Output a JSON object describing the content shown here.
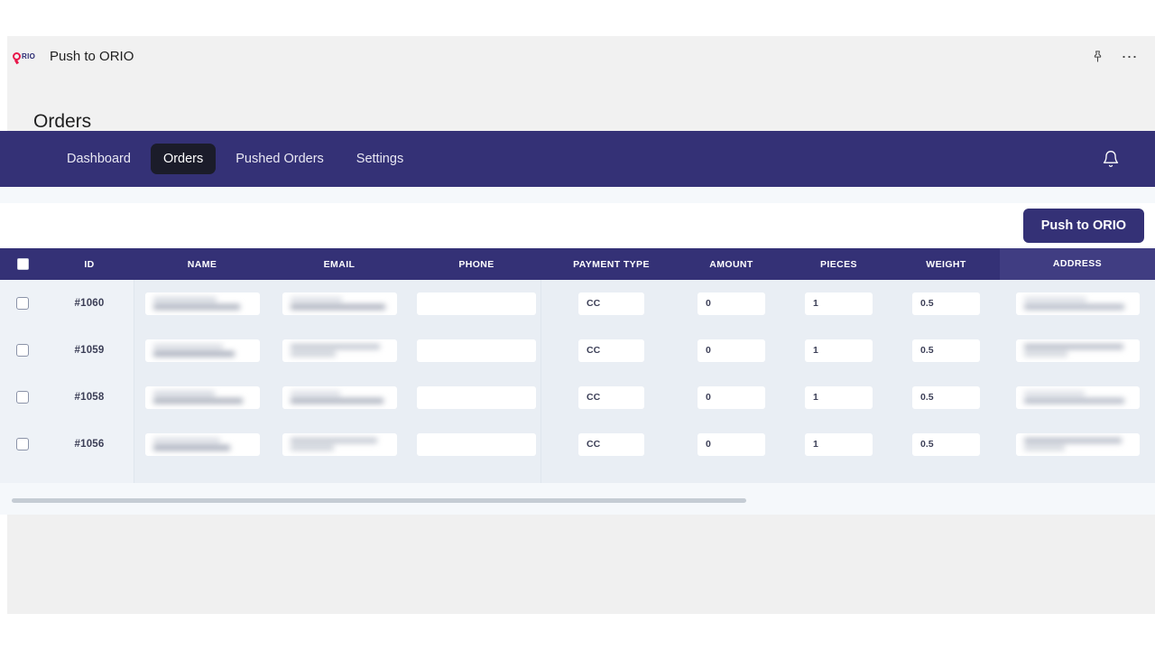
{
  "window": {
    "app_name": "Push to ORIO",
    "logo_text": "RIO",
    "pin_icon": "pin-icon",
    "more_icon": "ellipsis-icon"
  },
  "page": {
    "title": "Orders"
  },
  "nav": {
    "items": [
      {
        "label": "Dashboard",
        "active": false
      },
      {
        "label": "Orders",
        "active": true
      },
      {
        "label": "Pushed Orders",
        "active": false
      },
      {
        "label": "Settings",
        "active": false
      }
    ],
    "bell_icon": "bell-icon"
  },
  "toolbar": {
    "push_label": "Push to ORIO"
  },
  "table": {
    "columns": [
      {
        "key": "select",
        "label": ""
      },
      {
        "key": "id",
        "label": "ID"
      },
      {
        "key": "name",
        "label": "NAME"
      },
      {
        "key": "email",
        "label": "EMAIL"
      },
      {
        "key": "phone",
        "label": "PHONE"
      },
      {
        "key": "payment_type",
        "label": "PAYMENT TYPE"
      },
      {
        "key": "amount",
        "label": "AMOUNT"
      },
      {
        "key": "pieces",
        "label": "PIECES"
      },
      {
        "key": "weight",
        "label": "WEIGHT"
      },
      {
        "key": "address",
        "label": "ADDRESS"
      }
    ],
    "header_select_all_checked": false,
    "hovered_column": "ADDRESS",
    "rows": [
      {
        "selected": false,
        "id": "#1060",
        "name": "",
        "email": "",
        "phone": "",
        "payment_type": "CC",
        "amount": "0",
        "pieces": "1",
        "weight": "0.5",
        "address": "",
        "name_redacted": true,
        "email_redacted": true,
        "address_redacted": true
      },
      {
        "selected": false,
        "id": "#1059",
        "name": "",
        "email": "",
        "phone": "",
        "payment_type": "CC",
        "amount": "0",
        "pieces": "1",
        "weight": "0.5",
        "address": "",
        "name_redacted": true,
        "email_redacted": true,
        "address_redacted": true
      },
      {
        "selected": false,
        "id": "#1058",
        "name": "",
        "email": "",
        "phone": "",
        "payment_type": "CC",
        "amount": "0",
        "pieces": "1",
        "weight": "0.5",
        "address": "",
        "name_redacted": true,
        "email_redacted": true,
        "address_redacted": true
      },
      {
        "selected": false,
        "id": "#1056",
        "name": "",
        "email": "",
        "phone": "",
        "payment_type": "CC",
        "amount": "0",
        "pieces": "1",
        "weight": "0.5",
        "address": "",
        "name_redacted": true,
        "email_redacted": true,
        "address_redacted": true
      }
    ]
  },
  "scrollbar": {
    "orientation": "horizontal",
    "thumb_fraction": 0.65
  },
  "colors": {
    "nav_navy": "#343176",
    "active_pill": "#1b1c2a",
    "logo_red": "#e8174a",
    "content_bg": "#f5f8fb",
    "row_bg": "#e9eef4",
    "frame_bg": "#f0f0f0"
  }
}
